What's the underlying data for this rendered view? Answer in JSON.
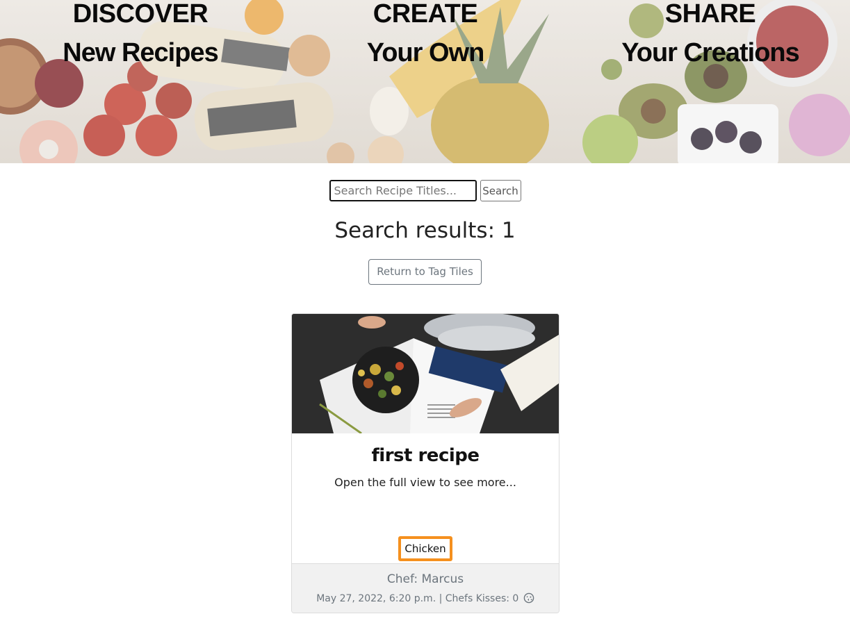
{
  "hero": {
    "columns": [
      {
        "heading": "DISCOVER",
        "subheading": "New Recipes"
      },
      {
        "heading": "CREATE",
        "subheading": "Your Own"
      },
      {
        "heading": "SHARE",
        "subheading": "Your Creations"
      }
    ]
  },
  "search": {
    "placeholder": "Search Recipe Titles...",
    "value": "",
    "button_label": "Search"
  },
  "results": {
    "title": "Search results: 1",
    "return_label": "Return to Tag Tiles"
  },
  "recipes": [
    {
      "title": "first recipe",
      "summary": "Open the full view to see more...",
      "tag": "Chicken",
      "chef": "Chef: Marcus",
      "meta": "May 27, 2022, 6:20 p.m. | Chefs Kisses: 0",
      "kiss_icon": "kiss-face-icon"
    }
  ],
  "colors": {
    "tag_border": "#f5901e",
    "footer_bg": "#f1f1f1",
    "muted_text": "#6c757d"
  }
}
